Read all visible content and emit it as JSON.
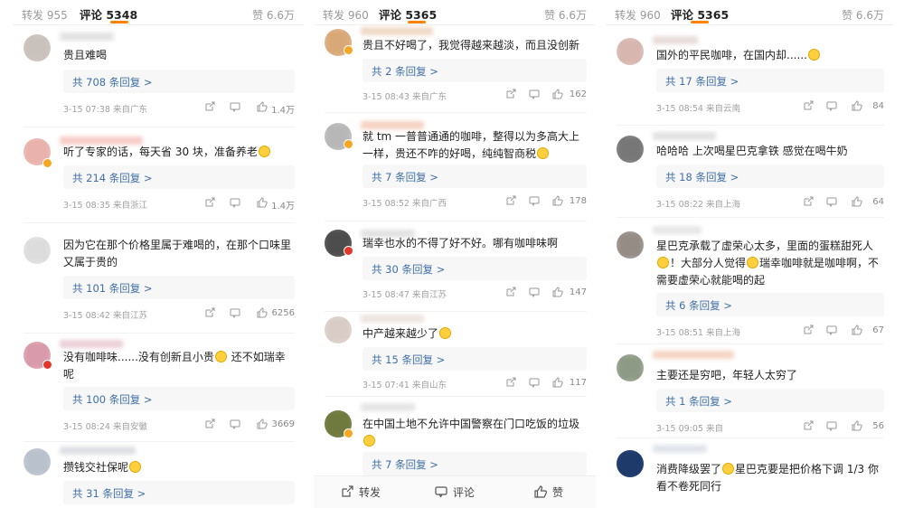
{
  "colors": {
    "accent": "#ff8200",
    "link": "#3f6fa8",
    "meta": "#a0a0a0"
  },
  "icons": [
    "share-icon",
    "comment-icon",
    "like-icon",
    "emoji-icon"
  ],
  "panels": [
    {
      "tabs": {
        "repost": "转发 955",
        "comments": "评论 5348",
        "likes": "赞 6.6万"
      },
      "comments": [
        {
          "text": "贵且难喝",
          "reply": "共 708 条回复 >",
          "meta": "3-15 07:38  来自广东",
          "likes": "1.4万"
        },
        {
          "text": "听了专家的话，每天省 30 块，准备养老",
          "reply": "共 214 条回复 >",
          "meta": "3-15 08:35  来自浙江",
          "likes": "1.4万"
        },
        {
          "text": "因为它在那个价格里属于难喝的，在那个口味里又属于贵的",
          "reply": "共 101 条回复 >",
          "meta": "3-15 08:42  来自江苏",
          "likes": "6256"
        },
        {
          "text": "没有咖啡味......没有创新且小贵",
          "text2": " 还不如瑞幸呢",
          "reply": "共 100 条回复 >",
          "meta": "3-15 08:24  来自安徽",
          "likes": "3669"
        },
        {
          "text": "攒钱交社保呢",
          "reply": "共 31 条回复 >"
        }
      ]
    },
    {
      "tabs": {
        "repost": "转发 960",
        "comments": "评论 5365",
        "likes": "赞 6.6万"
      },
      "comments": [
        {
          "text": "贵且不好喝了，我觉得越来越淡，而且没创新",
          "reply": "共 2 条回复 >",
          "meta": "3-15 08:43  来自广东",
          "likes": "162"
        },
        {
          "text": "就 tm 一普普通通的咖啡，整得以为多高大上一样，贵还不咋的好喝，纯纯智商税",
          "reply": "共 7 条回复 >",
          "meta": "3-15 08:52  来自广西",
          "likes": "178"
        },
        {
          "text": "瑞幸也水的不得了好不好。哪有咖啡味啊",
          "reply": "共 30 条回复 >",
          "meta": "3-15 08:47  来自江苏",
          "likes": "147"
        },
        {
          "text": "中产越来越少了",
          "reply": "共 15 条回复 >",
          "meta": "3-15 07:41  来自山东",
          "likes": "117"
        },
        {
          "text": "在中国土地不允许中国警察在门口吃饭的垃圾",
          "reply": "共 7 条回复 >"
        }
      ],
      "actionbar": {
        "share": "转发",
        "comment": "评论",
        "like": "赞"
      }
    },
    {
      "tabs": {
        "repost": "转发 960",
        "comments": "评论 5365",
        "likes": "赞 6.6万"
      },
      "comments": [
        {
          "text": "国外的平民咖啡，在国内却......",
          "reply": "共 17 条回复 >",
          "meta": "3-15 08:54  来自云南",
          "likes": "84"
        },
        {
          "text": "哈哈哈 上次喝星巴克拿铁  感觉在喝牛奶",
          "reply": "共 18 条回复 >",
          "meta": "3-15 08:22  来自上海",
          "likes": "64"
        },
        {
          "text": "星巴克承载了虚荣心太多，里面的蛋糕甜死人",
          "text2": "！大部分人觉得",
          "text3": "瑞幸咖啡就是咖啡啊，不需要虚荣心就能喝的起",
          "reply": "共 6 条回复 >",
          "meta": "3-15 08:51  来自上海",
          "likes": "67"
        },
        {
          "text": "主要还是穷吧，年轻人太穷了",
          "reply": "共 1 条回复 >",
          "meta": "3-15 09:05  来自",
          "likes": "56"
        },
        {
          "text": "消费降级罢了",
          "text2": "星巴克要是把价格下调 1/3 你看不卷死同行"
        }
      ]
    }
  ]
}
